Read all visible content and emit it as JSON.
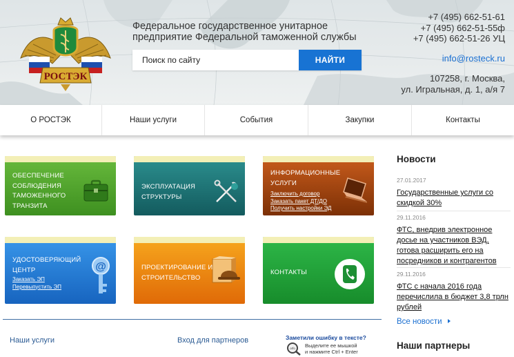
{
  "header": {
    "logo_text": "РОСТЭК",
    "org_line1": "Федеральное государственное унитарное",
    "org_line2": "предприятие Федеральной таможенной службы",
    "search": {
      "placeholder": "Поиск по сайту",
      "button_label": "НАЙТИ"
    },
    "phones": [
      "+7 (495) 662-51-61",
      "+7 (495) 662-51-55ф",
      "+7 (495) 662-51-26 УЦ"
    ],
    "email": "info@rosteck.ru",
    "address_line1": "107258, г. Москва,",
    "address_line2": "ул. Игральная, д. 1, а/я 7"
  },
  "nav": {
    "items": [
      "О РОСТЭК",
      "Наши услуги",
      "События",
      "Закупки",
      "Контакты"
    ]
  },
  "tiles": [
    {
      "lines": [
        "ОБЕСПЕЧЕНИЕ",
        "СОБЛЮДЕНИЯ",
        "ТАМОЖЕННОГО",
        "ТРАНЗИТА"
      ],
      "icon": "briefcase-icon"
    },
    {
      "lines": [
        "ЭКСПЛУАТАЦИЯ",
        "СТРУКТУРЫ"
      ],
      "icon": "tools-icon"
    },
    {
      "lines": [
        "ИНФОРМАЦИОННЫЕ",
        "УСЛУГИ"
      ],
      "links": [
        "Заключить договор",
        "Заказать пакет ДТ/ДО",
        "Получить настройки ЭД"
      ],
      "icon": "laptop-icon"
    },
    {
      "lines": [
        "УДОСТОВЕРЯЮЩИЙ",
        "ЦЕНТР"
      ],
      "links": [
        "Заказать ЭП",
        "Перевыпустить ЭП"
      ],
      "icon": "key-at-icon"
    },
    {
      "lines": [
        "ПРОЕКТИРОВАНИЕ И",
        "СТРОИТЕЛЬСТВО"
      ],
      "icon": "construction-icon"
    },
    {
      "lines": [
        "КОНТАКТЫ"
      ],
      "icon": "phone-icon"
    }
  ],
  "footer": {
    "services": "Наши услуги",
    "partners_login": "Вход для партнеров",
    "typo_question": "Заметили ошибку в тексте?",
    "typo_hint1": "Выделите ее мышкой",
    "typo_hint2": "и нажмите Ctrl + Enter",
    "typo_badge": "orfo"
  },
  "sidebar": {
    "news_heading": "Новости",
    "news": [
      {
        "date": "27.01.2017",
        "title": "Государственные услуги со скидкой 30%"
      },
      {
        "date": "29.11.2016",
        "title": "ФТС, внедрив электронное досье на участников ВЭД, готова расширить его на посредников и контрагентов"
      },
      {
        "date": "29.11.2016",
        "title": "ФТС с начала 2016 года перечислила в бюджет 3,8 трлн рублей"
      }
    ],
    "all_news": "Все новости",
    "partners_heading": "Наши партнеры"
  },
  "colors": {
    "accent": "#1873d3",
    "link": "#1a6fd1",
    "tile_green": "#4aa42a",
    "tile_teal": "#1d7375",
    "tile_brown": "#a2460f",
    "tile_blue": "#2a7fd8",
    "tile_orange": "#f08a12",
    "tile_green2": "#22a03a",
    "tile_top_band": "#f3efb6"
  }
}
